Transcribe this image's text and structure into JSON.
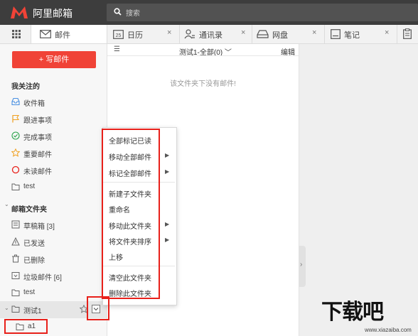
{
  "header": {
    "logo_text": "阿里邮箱",
    "search_placeholder": "搜索"
  },
  "tabs": [
    {
      "label": "邮件",
      "icon": "mail-icon"
    },
    {
      "label": "日历",
      "icon": "calendar-icon",
      "close": "×"
    },
    {
      "label": "通讯录",
      "icon": "contacts-icon",
      "close": "×"
    },
    {
      "label": "网盘",
      "icon": "disk-icon",
      "close": "×"
    },
    {
      "label": "笔记",
      "icon": "note-icon",
      "close": "×"
    }
  ],
  "calendar_badge": "25",
  "sidebar": {
    "compose_label": "+ 写邮件",
    "focus_title": "我关注的",
    "focus_items": [
      {
        "label": "收件箱",
        "icon": "inbox-icon"
      },
      {
        "label": "跟进事项",
        "icon": "flag-icon"
      },
      {
        "label": "完成事项",
        "icon": "check-circle-icon"
      },
      {
        "label": "重要邮件",
        "icon": "star-icon"
      },
      {
        "label": "未读邮件",
        "icon": "unread-circle-icon"
      },
      {
        "label": "test",
        "icon": "folder-icon"
      }
    ],
    "folders_title": "邮箱文件夹",
    "folder_items": [
      {
        "label": "草稿箱 [3]",
        "icon": "drafts-icon"
      },
      {
        "label": "已发送",
        "icon": "sent-icon"
      },
      {
        "label": "已删除",
        "icon": "trash-icon"
      },
      {
        "label": "垃圾邮件 [6]",
        "icon": "spam-icon"
      },
      {
        "label": "test",
        "icon": "folder-icon"
      },
      {
        "label": "测试1",
        "icon": "folder-icon"
      },
      {
        "label": "a1",
        "icon": "folder-icon"
      }
    ]
  },
  "list": {
    "folder_title": "测试1-全部(0)",
    "edit_label": "编辑",
    "empty_message": "该文件夹下没有邮件!"
  },
  "context_menu": {
    "items": [
      {
        "label": "全部标记已读",
        "submenu": false
      },
      {
        "label": "移动全部邮件",
        "submenu": true
      },
      {
        "label": "标记全部邮件",
        "submenu": true
      },
      {
        "label": "新建子文件夹",
        "submenu": false
      },
      {
        "label": "重命名",
        "submenu": false
      },
      {
        "label": "移动此文件夹",
        "submenu": true
      },
      {
        "label": "将文件夹排序",
        "submenu": true
      },
      {
        "label": "上移",
        "submenu": false
      },
      {
        "label": "清空此文件夹",
        "submenu": false
      },
      {
        "label": "删除此文件夹",
        "submenu": false
      }
    ],
    "submenu_arrow": "▶"
  },
  "watermark": {
    "text": "下载吧",
    "url": "www.xiazaiba.com"
  },
  "colors": {
    "accent": "#f04337",
    "highlight": "#e8201a",
    "header_bg": "#3d3d3d"
  }
}
